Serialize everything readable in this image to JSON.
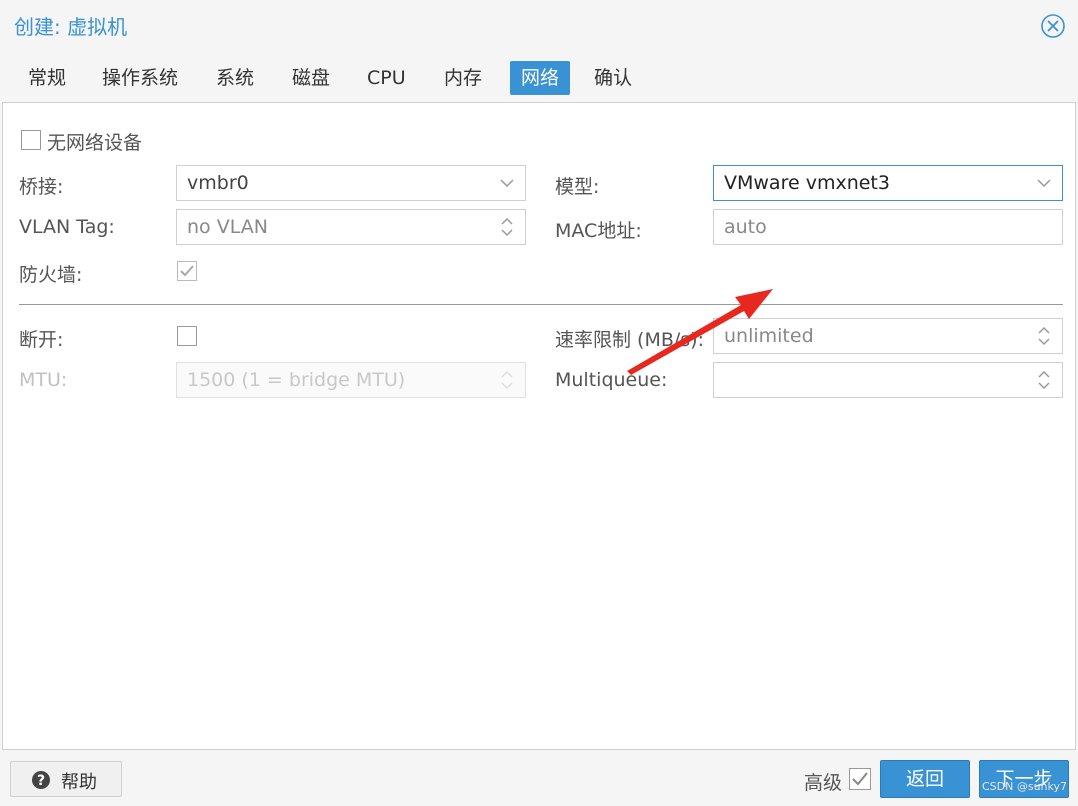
{
  "window": {
    "title": "创建: 虚拟机"
  },
  "tabs": [
    {
      "label": "常规"
    },
    {
      "label": "操作系统"
    },
    {
      "label": "系统"
    },
    {
      "label": "磁盘"
    },
    {
      "label": "CPU"
    },
    {
      "label": "内存"
    },
    {
      "label": "网络",
      "active": true
    },
    {
      "label": "确认"
    }
  ],
  "form": {
    "no_network_device_label": "无网络设备",
    "bridge_label": "桥接:",
    "bridge_value": "vmbr0",
    "model_label": "模型:",
    "model_value": "VMware vmxnet3",
    "vlan_label": "VLAN Tag:",
    "vlan_value": "no VLAN",
    "mac_label": "MAC地址:",
    "mac_value": "auto",
    "firewall_label": "防火墙:",
    "firewall_checked": true,
    "disconnect_label": "断开:",
    "disconnect_checked": false,
    "rate_label": "速率限制 (MB/s):",
    "rate_value": "unlimited",
    "mtu_label": "MTU:",
    "mtu_value": "1500 (1 = bridge MTU)",
    "multiqueue_label": "Multiqueue:",
    "multiqueue_value": ""
  },
  "footer": {
    "help_label": "帮助",
    "advanced_label": "高级",
    "advanced_checked": true,
    "back_label": "返回",
    "next_label": "下一步"
  },
  "watermark": "CSDN @sunky7",
  "colors": {
    "accent": "#3892d4",
    "annotation_arrow": "#e8281e"
  }
}
